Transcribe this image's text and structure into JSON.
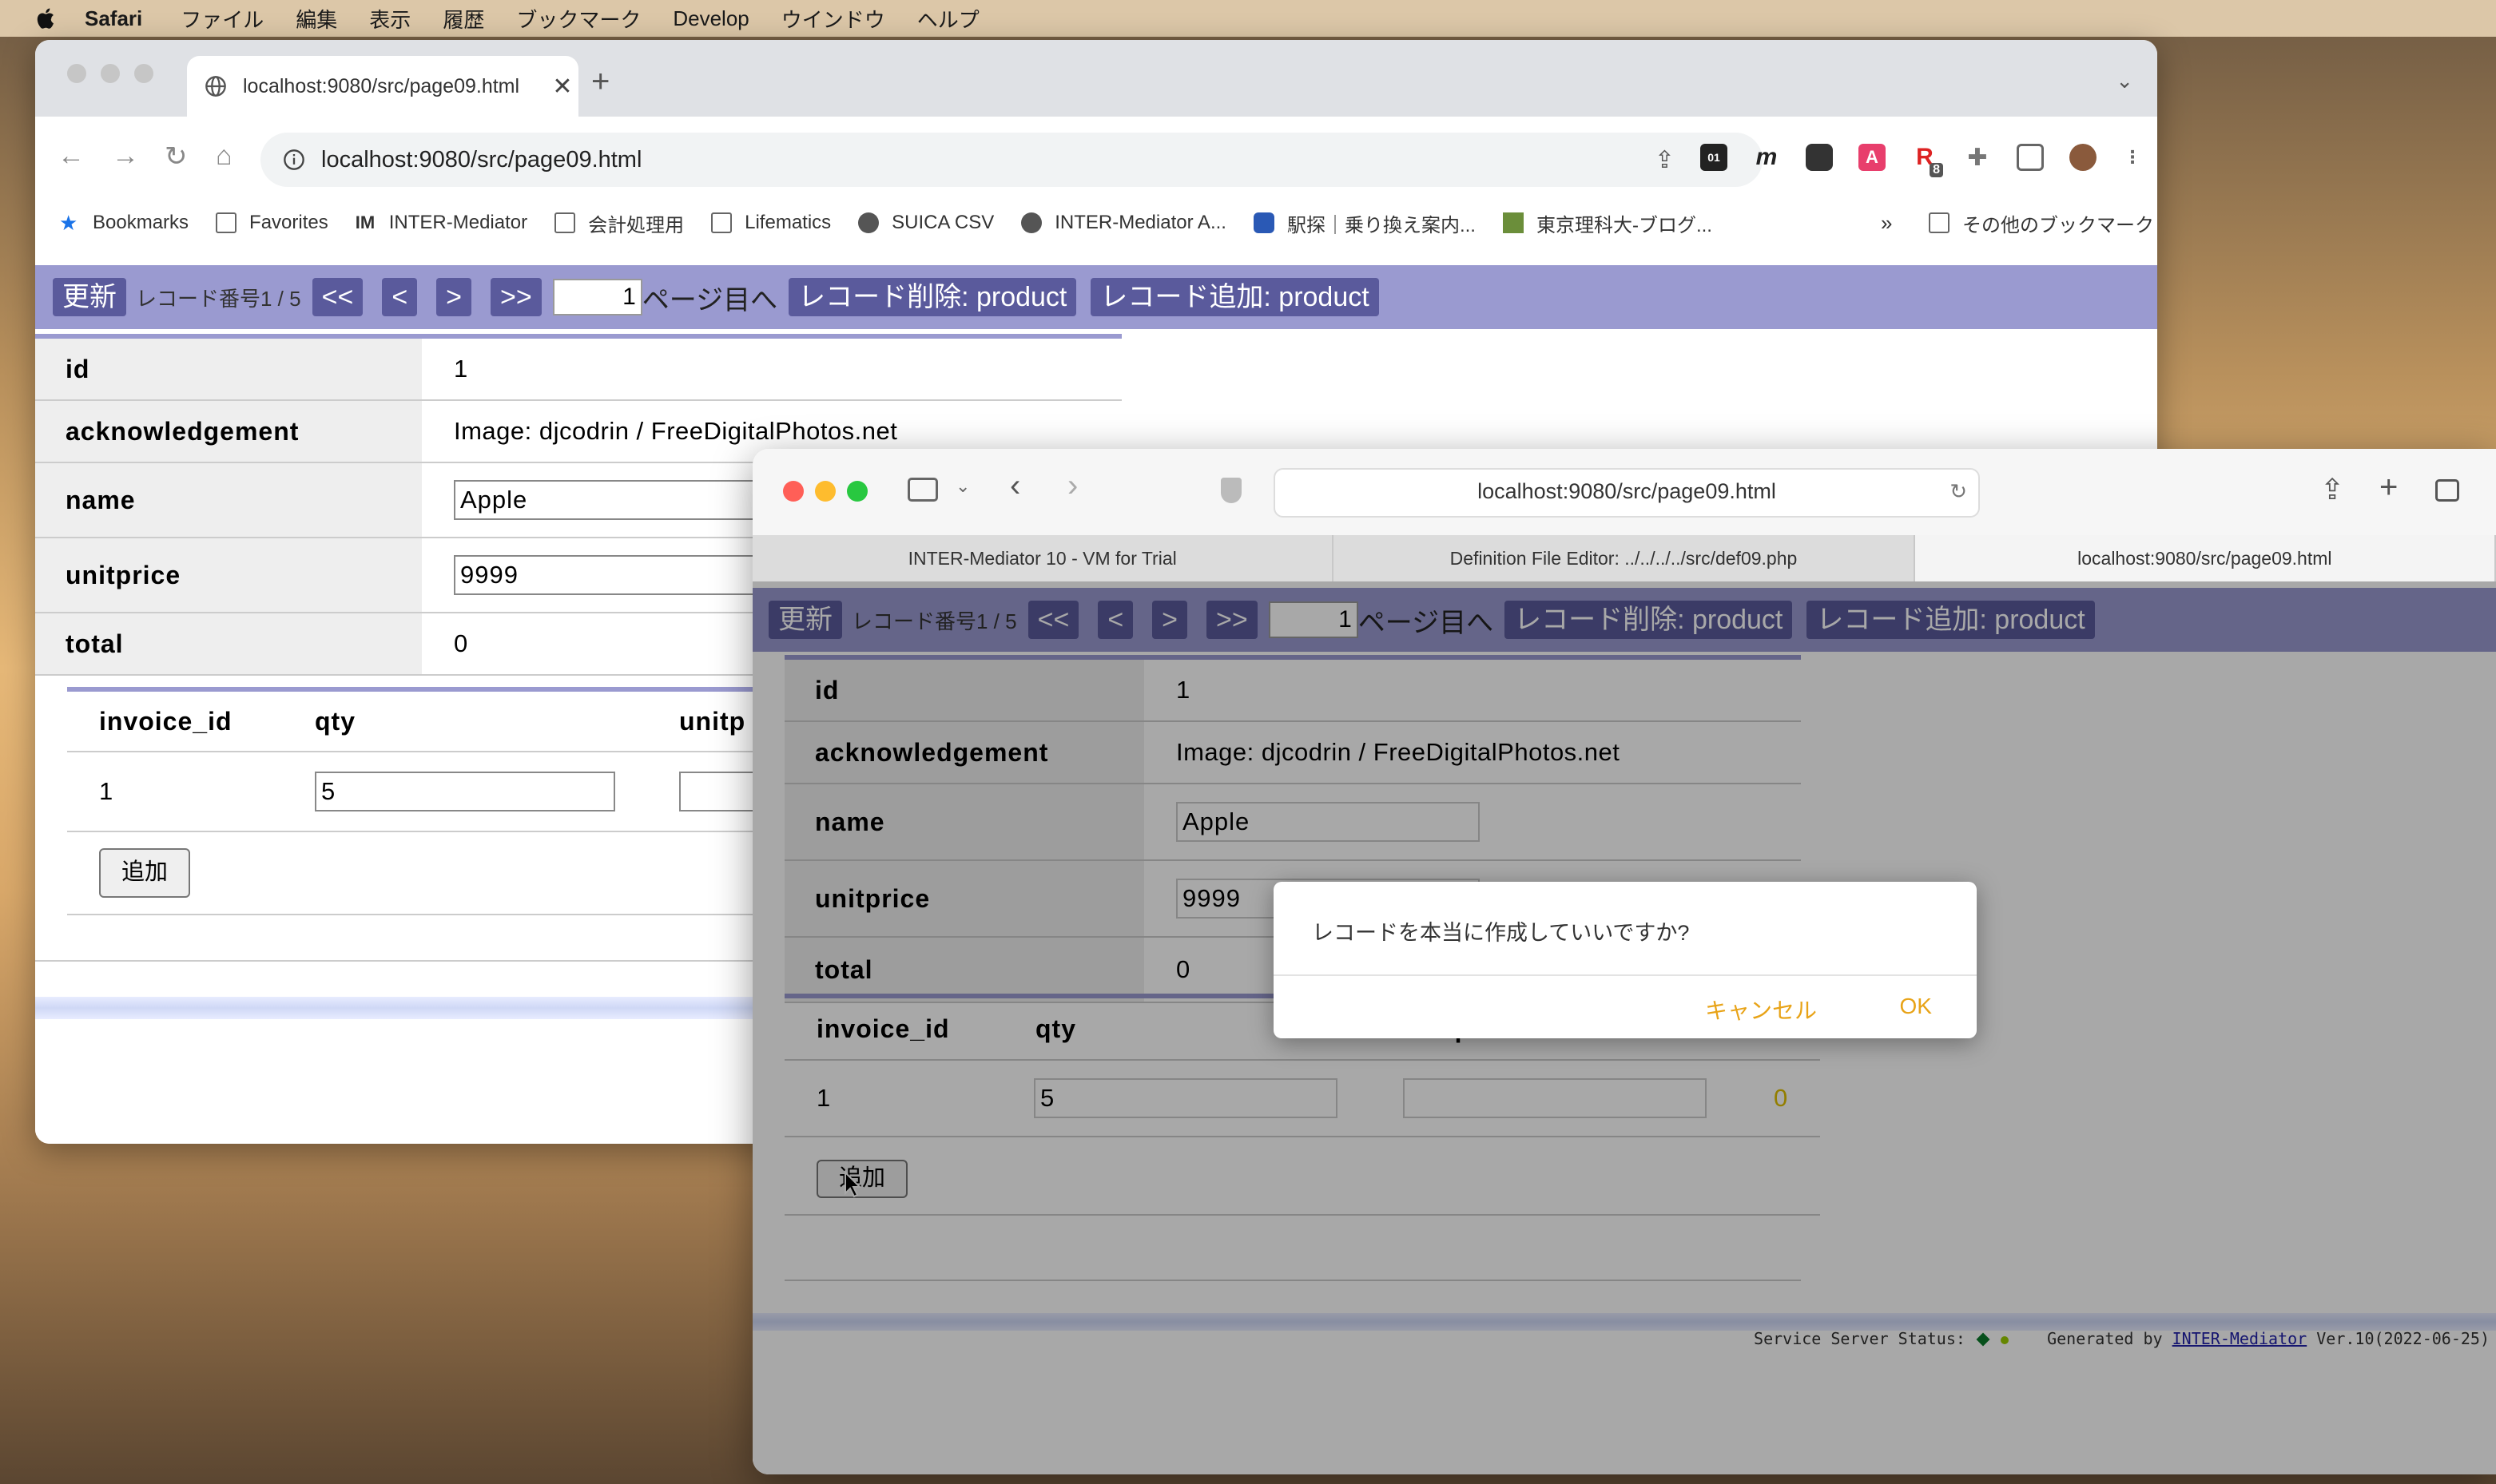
{
  "menubar": {
    "app": "Safari",
    "items": [
      "ファイル",
      "編集",
      "表示",
      "履歴",
      "ブックマーク",
      "Develop",
      "ウインドウ",
      "ヘルプ"
    ]
  },
  "chrome": {
    "tab_title": "localhost:9080/src/page09.html",
    "url": "localhost:9080/src/page09.html",
    "bookmarks": [
      {
        "label": "Bookmarks",
        "icon": "star-icon"
      },
      {
        "label": "Favorites",
        "icon": "folder-icon"
      },
      {
        "label": "INTER-Mediator",
        "icon": "im-logo-icon"
      },
      {
        "label": "会計処理用",
        "icon": "folder-icon"
      },
      {
        "label": "Lifematics",
        "icon": "folder-icon"
      },
      {
        "label": "SUICA CSV",
        "icon": "globe-icon"
      },
      {
        "label": "INTER-Mediator A...",
        "icon": "globe-icon"
      },
      {
        "label": "駅探｜乗り換え案内...",
        "icon": "ekitan-icon"
      },
      {
        "label": "東京理科大-ブログ...",
        "icon": "site-icon"
      }
    ],
    "more_bookmarks": "その他のブックマーク",
    "ext_badge": "8"
  },
  "safari": {
    "url": "localhost:9080/src/page09.html",
    "tabs": [
      "INTER-Mediator 10 - VM for Trial",
      "Definition File Editor: ../../../../src/def09.php",
      "localhost:9080/src/page09.html"
    ]
  },
  "im_page": {
    "refresh": "更新",
    "record_label": "レコード番号1 / 5",
    "first": "<<",
    "prev": "<",
    "next": ">",
    "last": ">>",
    "page_input": "1",
    "go_page": "ページ目へ",
    "delete": "レコード削除: product",
    "add": "レコード追加: product",
    "fields": {
      "id_label": "id",
      "id_value": "1",
      "ack_label": "acknowledgement",
      "ack_value": "Image: djcodrin / FreeDigitalPhotos.net",
      "name_label": "name",
      "name_value": "Apple",
      "unitprice_label": "unitprice",
      "unitprice_value": "9999",
      "total_label": "total",
      "total_value": "0"
    },
    "sub_headers": {
      "invoice_id": "invoice_id",
      "qty": "qty",
      "unitprice": "unitprice",
      "unitprice_short": "unitp"
    },
    "sub_row": {
      "invoice_id": "1",
      "qty": "5",
      "unitprice": "",
      "amount": "0"
    },
    "add_row": "追加"
  },
  "dialog": {
    "message": "レコードを本当に作成していいですか?",
    "cancel": "キャンセル",
    "ok": "OK"
  },
  "footer": {
    "status": "Service Server Status:",
    "generated": "Generated by",
    "link": "INTER-Mediator",
    "version": "Ver.10(2022-06-25)"
  }
}
